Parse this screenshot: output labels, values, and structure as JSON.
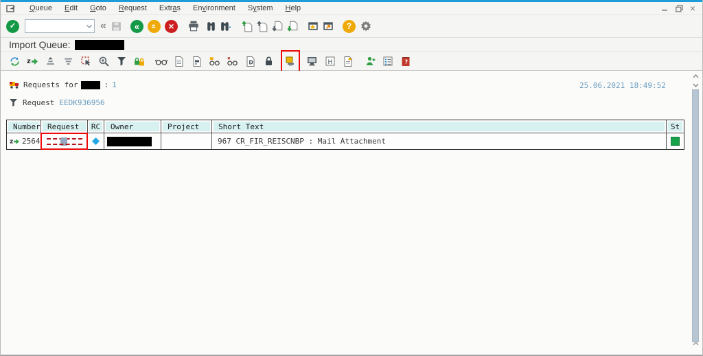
{
  "menu_bar": {
    "items": [
      {
        "label": "Queue",
        "mnemonic": "Q"
      },
      {
        "label": "Edit",
        "mnemonic": "E"
      },
      {
        "label": "Goto",
        "mnemonic": "G"
      },
      {
        "label": "Request",
        "mnemonic": "R"
      },
      {
        "label": "Extras",
        "mnemonic": "a"
      },
      {
        "label": "Environment",
        "mnemonic": "v"
      },
      {
        "label": "System",
        "mnemonic": "y"
      },
      {
        "label": "Help",
        "mnemonic": "H"
      }
    ]
  },
  "command_field": {
    "value": ""
  },
  "title": {
    "label": "Import Queue:"
  },
  "requests_line": {
    "prefix": "Requests for",
    "separator": ":",
    "count": "1"
  },
  "filter_line": {
    "label": "Request",
    "value": "EEDK936956"
  },
  "timestamp": "25.06.2021 18:49:52",
  "table": {
    "columns": [
      "Number",
      "Request",
      "RC",
      "Owner",
      "Project",
      "Short Text",
      "St"
    ],
    "row": {
      "number": "2564",
      "short_text": "967 CR_FIR_REISCNBP : Mail Attachment"
    }
  },
  "colors": {
    "accent_blue": "#1e9cd8",
    "header_cyan": "#d7f0f0",
    "list_blue": "#6699bb",
    "status_green": "#17a24a",
    "annotation_red": "#ee0a0a"
  }
}
